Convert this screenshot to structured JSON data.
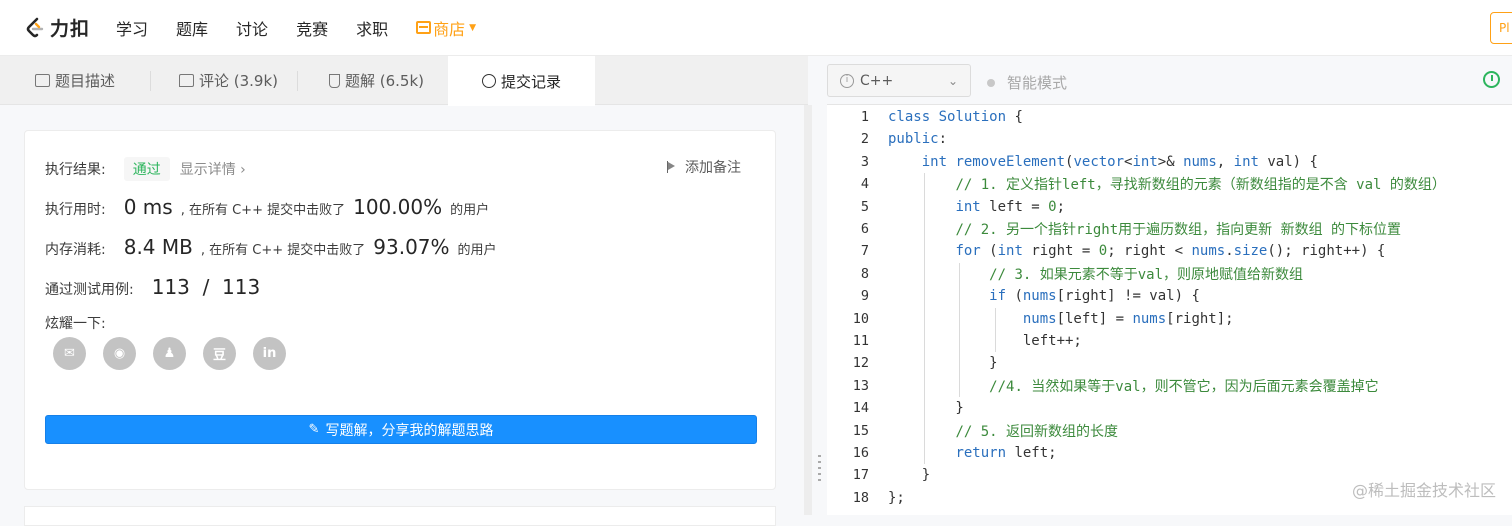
{
  "nav": {
    "brand": "力扣",
    "items": [
      "学习",
      "题库",
      "讨论",
      "竞赛",
      "求职"
    ],
    "store": "商店",
    "premium": "Pl"
  },
  "tabs": [
    {
      "label": "题目描述",
      "icon": "doc-icon"
    },
    {
      "label": "评论 (3.9k)",
      "icon": "comment-icon"
    },
    {
      "label": "题解 (6.5k)",
      "icon": "flask-icon"
    },
    {
      "label": "提交记录",
      "icon": "clock-icon"
    }
  ],
  "result": {
    "status_label": "执行结果:",
    "status": "通过",
    "show_detail": "显示详情 ›",
    "add_note": "添加备注",
    "runtime_label": "执行用时:",
    "runtime": "0 ms",
    "runtime_mid": ", 在所有 C++ 提交中击败了",
    "runtime_pct": "100.00%",
    "runtime_tail": "的用户",
    "memory_label": "内存消耗:",
    "memory": "8.4 MB",
    "memory_mid": ", 在所有 C++ 提交中击败了",
    "memory_pct": "93.07%",
    "memory_tail": "的用户",
    "tests_label": "通过测试用例:",
    "tests": "113  /  113",
    "share_label": "炫耀一下:",
    "share_icons": [
      "wechat-icon",
      "weibo-icon",
      "qq-icon",
      "douban-icon",
      "linkedin-icon"
    ],
    "share_glyphs": [
      "✉",
      "◉",
      "♟",
      "豆",
      "in"
    ],
    "write_solution": "写题解，分享我的解题思路"
  },
  "editor": {
    "language": "C++",
    "smart_mode": "智能模式",
    "lines": [
      "class Solution {",
      "public:",
      "    int removeElement(vector<int>& nums, int val) {",
      "        // 1. 定义指针left，寻找新数组的元素（新数组指的是不含 val 的数组）",
      "        int left = 0;",
      "        // 2. 另一个指针right用于遍历数组，指向更新 新数组 的下标位置",
      "        for (int right = 0; right < nums.size(); right++) {",
      "            // 3. 如果元素不等于val，则原地赋值给新数组",
      "            if (nums[right] != val) {",
      "                nums[left] = nums[right];",
      "                left++;",
      "            }",
      "            //4. 当然如果等于val，则不管它，因为后面元素会覆盖掉它",
      "        }",
      "        // 5. 返回新数组的长度",
      "        return left;",
      "    }",
      "};"
    ]
  },
  "watermark": "@稀土掘金技术社区"
}
